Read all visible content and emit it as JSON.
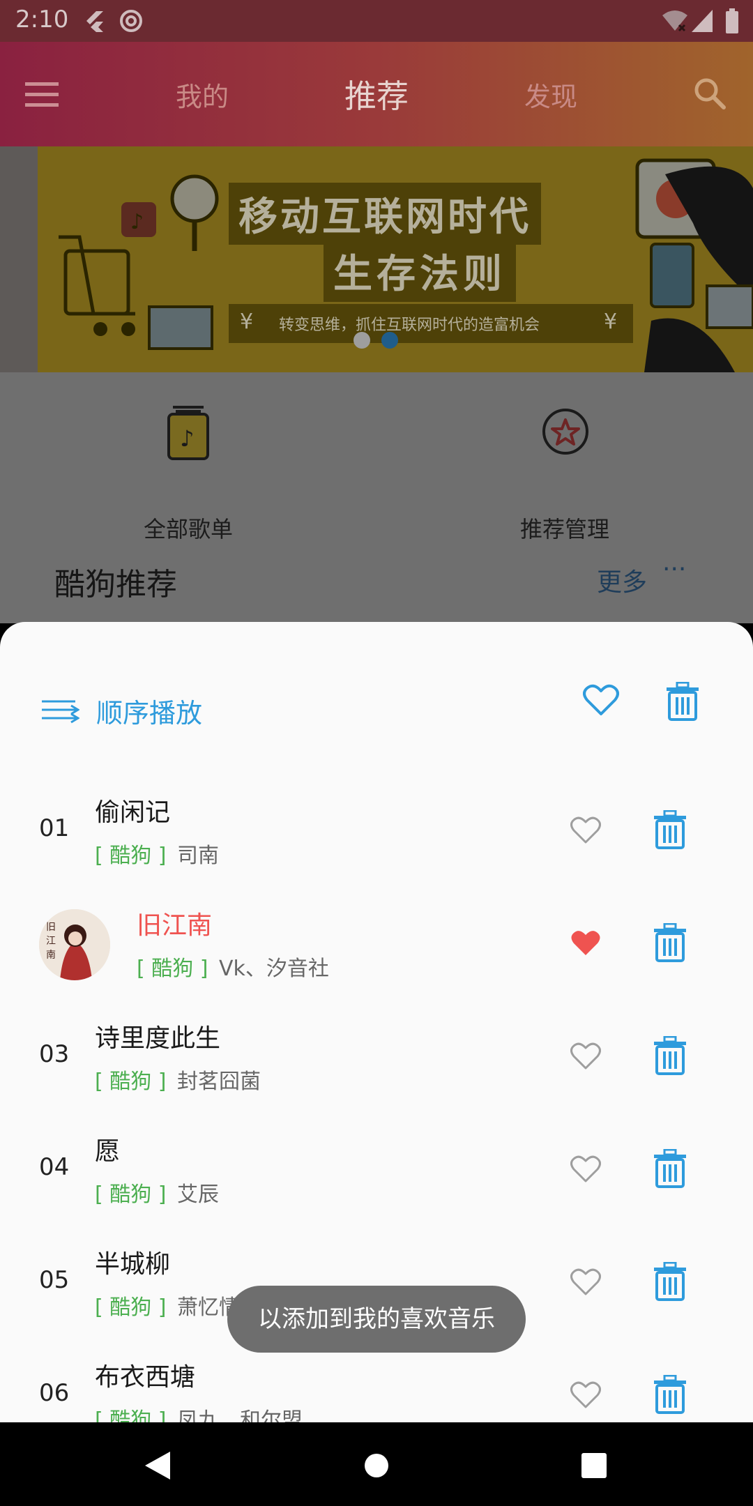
{
  "status_bar": {
    "time": "2:10"
  },
  "app_bar": {
    "tabs": [
      {
        "label": "我的"
      },
      {
        "label": "推荐"
      },
      {
        "label": "发现"
      }
    ]
  },
  "banner": {
    "title_line1": "移动互联网时代",
    "title_line2": "生存法则",
    "tagline": "转变思维，抓住互联网时代的造富机会",
    "currency_symbol": "¥",
    "dots_total": 2,
    "active_dot": 2
  },
  "quick_actions": [
    {
      "label": "全部歌单",
      "icon": "playlist-music-icon"
    },
    {
      "label": "推荐管理",
      "icon": "star-circle-icon"
    }
  ],
  "section": {
    "title": "酷狗推荐",
    "more_label": "更多",
    "more_icon": "ellipsis-icon"
  },
  "sheet": {
    "play_mode_label": "顺序播放",
    "songs": [
      {
        "num": "01",
        "title": "偷闲记",
        "source": "[ 酷狗 ]",
        "artist": "司南",
        "liked": false,
        "playing": false
      },
      {
        "num": "",
        "title": "旧江南",
        "source": "[ 酷狗 ]",
        "artist": "Vk、汐音社",
        "liked": true,
        "playing": true
      },
      {
        "num": "03",
        "title": "诗里度此生",
        "source": "[ 酷狗 ]",
        "artist": "封茗囧菌",
        "liked": false,
        "playing": false
      },
      {
        "num": "04",
        "title": "愿",
        "source": "[ 酷狗 ]",
        "artist": "艾辰",
        "liked": false,
        "playing": false
      },
      {
        "num": "05",
        "title": "半城柳",
        "source": "[ 酷狗 ]",
        "artist": "萧忆情Alex",
        "liked": false,
        "playing": false
      },
      {
        "num": "06",
        "title": "布衣西塘",
        "source": "[ 酷狗 ]",
        "artist": "凤九、和尔盟",
        "liked": false,
        "playing": false
      }
    ]
  },
  "toast": {
    "message": "以添加到我的喜欢音乐"
  },
  "colors": {
    "accent": "#2e9bdc",
    "liked": "#ef5350",
    "source": "#4caf50"
  }
}
